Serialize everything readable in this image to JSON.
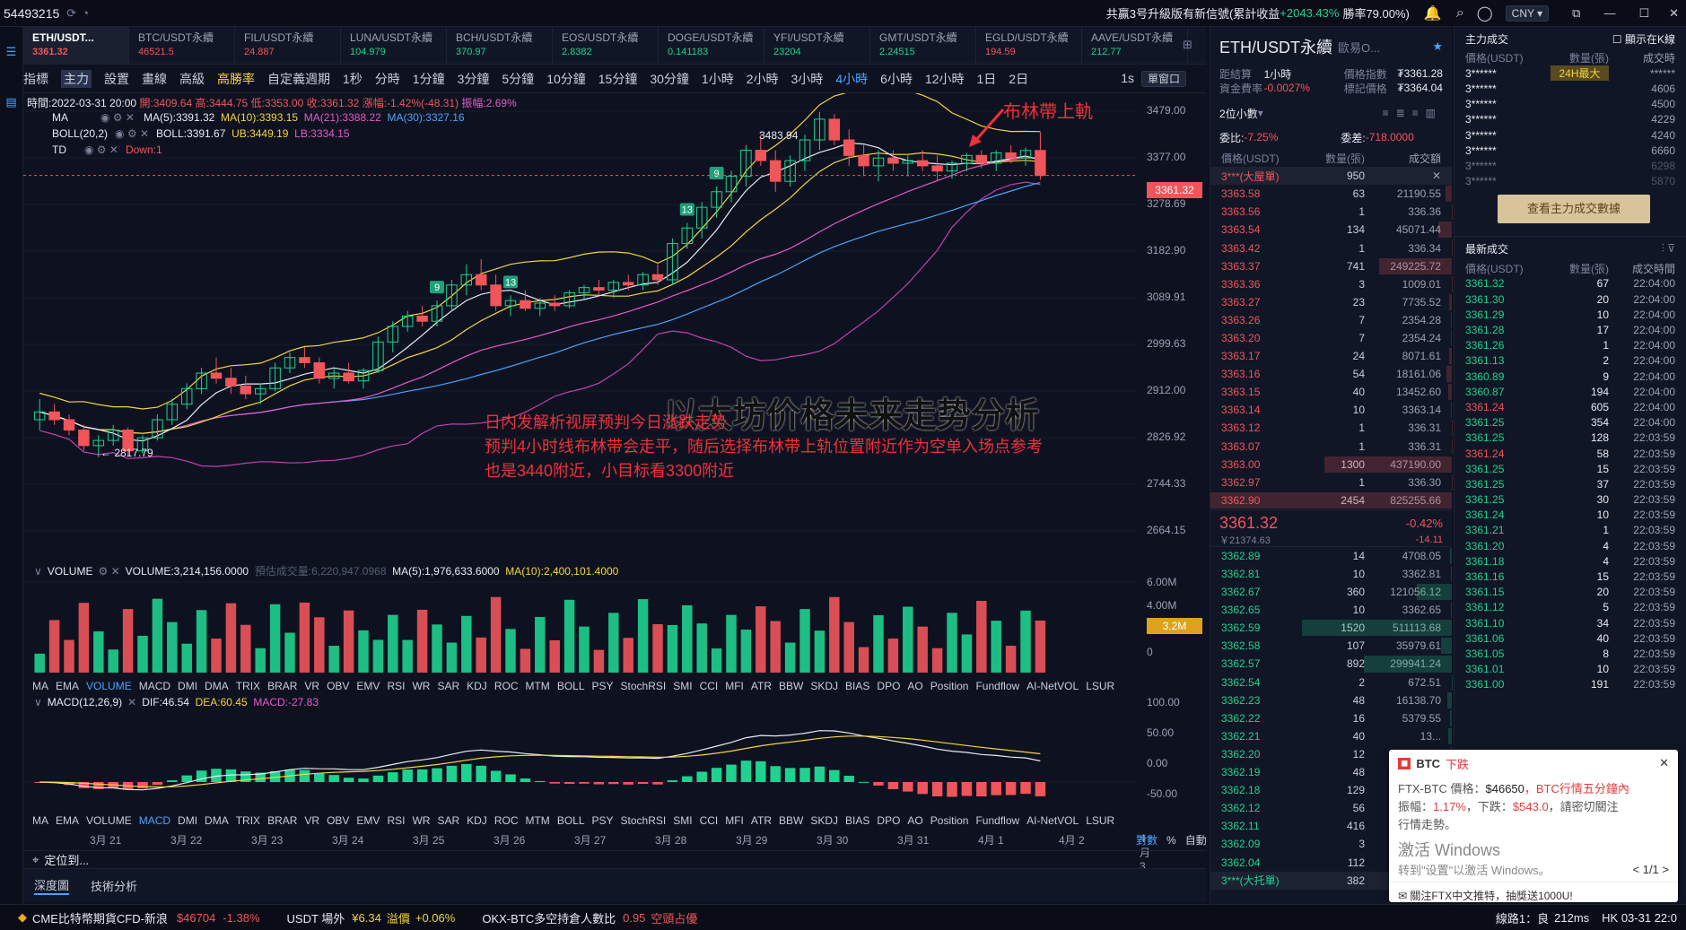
{
  "topbar": {
    "left_number": "54493215",
    "ticker": "共贏3号升級版有新信號(累計收益",
    "ticker_pct": "+2043.43%",
    "ticker_win": "勝率79.00%)",
    "currency": "CNY"
  },
  "tabs": [
    {
      "name": "ETH/USDT...",
      "price": "3361.32",
      "color": "#f0555a"
    },
    {
      "name": "BTC/USDT永續",
      "price": "46521.5",
      "color": "#f0555a"
    },
    {
      "name": "FIL/USDT永續",
      "price": "24.887",
      "color": "#f0555a"
    },
    {
      "name": "LUNA/USDT永續",
      "price": "104.979",
      "color": "#1fd28f"
    },
    {
      "name": "BCH/USDT永續",
      "price": "370.97",
      "color": "#1fd28f"
    },
    {
      "name": "EOS/USDT永續",
      "price": "2.8382",
      "color": "#1fd28f"
    },
    {
      "name": "DOGE/USDT永續",
      "price": "0.141183",
      "color": "#1fd28f"
    },
    {
      "name": "YFI/USDT永續",
      "price": "23204",
      "color": "#1fd28f"
    },
    {
      "name": "GMT/USDT永續",
      "price": "2.24515",
      "color": "#1fd28f"
    },
    {
      "name": "EGLD/USDT永續",
      "price": "194.59",
      "color": "#f0555a"
    },
    {
      "name": "AAVE/USDT永續",
      "price": "212.77",
      "color": "#1fd28f"
    }
  ],
  "toolbar": {
    "items": [
      "指標",
      "主力",
      "設置",
      "畫線",
      "高級",
      "高勝率",
      "自定義週期",
      "1秒",
      "分時",
      "1分鐘",
      "3分鐘",
      "5分鐘",
      "10分鐘",
      "15分鐘",
      "30分鐘",
      "1小時",
      "2小時",
      "3小時",
      "4小時",
      "6小時",
      "12小時",
      "1日",
      "2日"
    ],
    "active": "4小時",
    "right": [
      "1s",
      "單窗口"
    ]
  },
  "ohlc": {
    "time": "時間:2022-03-31 20:00",
    "open": "開:3409.64",
    "high": "高:3444.75",
    "low": "低:3353.00",
    "close": "收:3361.32",
    "change": "漲幅:-1.42%(-48.31)",
    "amp": "振幅:2.69%"
  },
  "ma_line": {
    "label": "MA",
    "ma5": "MA(5):3391.32",
    "ma10": "MA(10):3393.15",
    "ma21": "MA(21):3388.22",
    "ma30": "MA(30):3327.16"
  },
  "boll_line": {
    "label": "BOLL(20,2)",
    "boll": "BOLL:3391.67",
    "ub": "UB:3449.19",
    "lb": "LB:3334.15"
  },
  "td_line": {
    "label": "TD",
    "down": "Down:1"
  },
  "y_ticks": [
    "3479.00",
    "3377.00",
    "3278.69",
    "3182.90",
    "3089.91",
    "2999.63",
    "2912.00",
    "2826.92",
    "2744.33",
    "2664.15"
  ],
  "price_tag": "3361.32",
  "labels": {
    "high": "3483.94",
    "low": "← 2817.79",
    "boll_top": "布林帶上軌",
    "title_overlay": "以太坊价格未来走势分析",
    "note1": "日内发解析视屏预判今日涨跌走势",
    "note2": "预判4小时线布林带会走平，随后选择布林带上轨位置附近作为空单入场点参考",
    "note3": "也是3440附近，小目标看3300附近"
  },
  "td_marks": [
    "9",
    "13",
    "13",
    "9"
  ],
  "volume": {
    "label": "VOLUME",
    "value": "VOLUME:3,214,156.0000",
    "pred": "預估成交量:6,220,947.0968",
    "ma5": "MA(5):1,976,633.6000",
    "ma10": "MA(10):2,400,101.4000",
    "ticks": [
      "6.00M",
      "4.00M",
      "2.00M",
      "0"
    ],
    "tag": "3.2M"
  },
  "indicator_tabs1": [
    "MA",
    "EMA",
    "VOLUME",
    "MACD",
    "DMI",
    "DMA",
    "TRIX",
    "BRAR",
    "VR",
    "OBV",
    "EMV",
    "RSI",
    "WR",
    "SAR",
    "KDJ",
    "ROC",
    "MTM",
    "BOLL",
    "PSY",
    "StochRSI",
    "SMI",
    "CCI",
    "MFI",
    "ATR",
    "BBW",
    "SKDJ",
    "BIAS",
    "DPO",
    "AO",
    "Position",
    "Fundflow",
    "AI-NetVOL",
    "LSUR"
  ],
  "indicator_tabs2": [
    "MA",
    "EMA",
    "VOLUME",
    "MACD",
    "DMI",
    "DMA",
    "TRIX",
    "BRAR",
    "VR",
    "OBV",
    "EMV",
    "RSI",
    "WR",
    "SAR",
    "KDJ",
    "ROC",
    "MTM",
    "BOLL",
    "PSY",
    "StochRSI",
    "SMI",
    "CCI",
    "MFI",
    "ATR",
    "BBW",
    "SKDJ",
    "BIAS",
    "DPO",
    "AO",
    "Position",
    "Fundflow",
    "AI-NetVOL",
    "LSUR"
  ],
  "macd": {
    "label": "MACD(12,26,9)",
    "dif": "DIF:46.54",
    "dea": "DEA:60.45",
    "macd": "MACD:-27.83",
    "ticks": [
      "100.00",
      "50.00",
      "0.00",
      "-50.00"
    ]
  },
  "dates": [
    "3月 21",
    "3月 22",
    "3月 23",
    "3月 24",
    "3月 25",
    "3月 26",
    "3月 27",
    "3月 28",
    "3月 29",
    "3月 30",
    "3月 31",
    "4月 1",
    "4月 2",
    "4月 3"
  ],
  "date_right": [
    "對數",
    "%",
    "自動"
  ],
  "locate": "定位到...",
  "bottom_tabs": [
    "深度圖",
    "技術分析"
  ],
  "orderbook": {
    "title": "ETH/USDT永續",
    "exchange": "歐易O...",
    "info": [
      [
        "距結算",
        "1小時",
        "價格指數",
        "₮3361.28"
      ],
      [
        "資金費率",
        "-0.0027%",
        "標記價格",
        "₮3364.04"
      ]
    ],
    "precision": "2位小數",
    "ratio_label": "委比:",
    "ratio": "-7.25%",
    "diff_label": "委差:",
    "diff": "-718.0000",
    "headers": [
      "價格(USDT)",
      "數量(張)",
      "成交額"
    ],
    "big_ask": "3***(大屋單)",
    "big_ask_qty": "950",
    "asks": [
      [
        "3363.58",
        "63",
        "21190.55"
      ],
      [
        "3363.56",
        "1",
        "336.36"
      ],
      [
        "3363.54",
        "134",
        "45071.44"
      ],
      [
        "3363.42",
        "1",
        "336.34"
      ],
      [
        "3363.37",
        "741",
        "249225.72"
      ],
      [
        "3363.36",
        "3",
        "1009.01"
      ],
      [
        "3363.27",
        "23",
        "7735.52"
      ],
      [
        "3363.26",
        "7",
        "2354.28"
      ],
      [
        "3363.20",
        "7",
        "2354.24"
      ],
      [
        "3363.17",
        "24",
        "8071.61"
      ],
      [
        "3363.16",
        "54",
        "18161.06"
      ],
      [
        "3363.15",
        "40",
        "13452.60"
      ],
      [
        "3363.14",
        "10",
        "3363.14"
      ],
      [
        "3363.12",
        "1",
        "336.31"
      ],
      [
        "3363.07",
        "1",
        "336.31"
      ],
      [
        "3363.00",
        "1300",
        "437190.00"
      ],
      [
        "3362.97",
        "1",
        "336.30"
      ],
      [
        "3362.90",
        "2454",
        "825255.66"
      ]
    ],
    "last": "3361.32",
    "last_cny": "￥21374.63",
    "last_pct": "-0.42%",
    "last_chg": "-14.11",
    "bids": [
      [
        "3362.89",
        "14",
        "4708.05"
      ],
      [
        "3362.81",
        "10",
        "3362.81"
      ],
      [
        "3362.67",
        "360",
        "121056.12"
      ],
      [
        "3362.65",
        "10",
        "3362.65"
      ],
      [
        "3362.59",
        "1520",
        "511113.68"
      ],
      [
        "3362.58",
        "107",
        "35979.61"
      ],
      [
        "3362.57",
        "892",
        "299941.24"
      ],
      [
        "3362.54",
        "2",
        "672.51"
      ],
      [
        "3362.23",
        "48",
        "16138.70"
      ],
      [
        "3362.22",
        "16",
        "5379.55"
      ],
      [
        "3362.21",
        "40",
        "13..."
      ],
      [
        "3362.20",
        "12",
        "4..."
      ],
      [
        "3362.19",
        "48",
        "16..."
      ],
      [
        "3362.18",
        "129",
        "43..."
      ],
      [
        "3362.12",
        "56",
        "18..."
      ],
      [
        "3362.11",
        "416",
        "139..."
      ],
      [
        "3362.09",
        "3",
        "1..."
      ],
      [
        "3362.04",
        "112",
        "37..."
      ]
    ],
    "big_bid": "3***(大托單)",
    "big_bid_qty": "382"
  },
  "mainforce": {
    "title": "主力成交",
    "checkbox": "顯示在K線",
    "headers": [
      "價格(USDT)",
      "數量(張)",
      "成交時"
    ],
    "rows": [
      [
        "3******",
        "24H最大",
        "******"
      ],
      [
        "3******",
        "",
        "4606"
      ],
      [
        "3******",
        "",
        "4500"
      ],
      [
        "3******",
        "",
        "4229"
      ],
      [
        "3******",
        "",
        "4240"
      ],
      [
        "3******",
        "",
        "6660"
      ],
      [
        "3******",
        "",
        "6298"
      ],
      [
        "3******",
        "",
        "5870"
      ]
    ],
    "button": "查看主力成交數據"
  },
  "trades": {
    "title": "最新成交",
    "headers": [
      "價格(USDT)",
      "數量(張)",
      "成交時間"
    ],
    "rows": [
      [
        "3361.32",
        "67",
        "22:04:00",
        "g"
      ],
      [
        "3361.30",
        "20",
        "22:04:00",
        "g"
      ],
      [
        "3361.29",
        "10",
        "22:04:00",
        "g"
      ],
      [
        "3361.28",
        "17",
        "22:04:00",
        "g"
      ],
      [
        "3361.26",
        "1",
        "22:04:00",
        "g"
      ],
      [
        "3361.13",
        "2",
        "22:04:00",
        "g"
      ],
      [
        "3360.89",
        "9",
        "22:04:00",
        "g"
      ],
      [
        "3360.87",
        "194",
        "22:04:00",
        "g"
      ],
      [
        "3361.24",
        "605",
        "22:04:00",
        "r"
      ],
      [
        "3361.25",
        "354",
        "22:04:00",
        "g"
      ],
      [
        "3361.25",
        "128",
        "22:03:59",
        "g"
      ],
      [
        "3361.24",
        "58",
        "22:03:59",
        "r"
      ],
      [
        "3361.25",
        "15",
        "22:03:59",
        "g"
      ],
      [
        "3361.25",
        "37",
        "22:03:59",
        "g"
      ],
      [
        "3361.25",
        "30",
        "22:03:59",
        "g"
      ],
      [
        "3361.24",
        "10",
        "22:03:59",
        "g"
      ],
      [
        "3361.21",
        "1",
        "22:03:59",
        "g"
      ],
      [
        "3361.20",
        "4",
        "22:03:59",
        "g"
      ],
      [
        "3361.18",
        "4",
        "22:03:59",
        "g"
      ],
      [
        "3361.16",
        "15",
        "22:03:59",
        "g"
      ],
      [
        "3361.15",
        "20",
        "22:03:59",
        "g"
      ],
      [
        "3361.12",
        "5",
        "22:03:59",
        "g"
      ],
      [
        "3361.10",
        "34",
        "22:03:59",
        "g"
      ],
      [
        "3361.06",
        "40",
        "22:03:59",
        "g"
      ],
      [
        "3361.05",
        "8",
        "22:03:59",
        "g"
      ],
      [
        "3361.01",
        "10",
        "22:03:59",
        "g"
      ],
      [
        "3361.00",
        "191",
        "22:03:59",
        "g"
      ]
    ]
  },
  "popup": {
    "title": "BTC",
    "badge": "下跌",
    "line1a": "FTX-BTC 價格：",
    "line1b": "$46650",
    "line1c": "，BTC行情五分鐘內",
    "line2a": "振幅：",
    "line2b": "1.17%",
    "line2c": "，下跌：",
    "line2d": "$543.0",
    "line2e": "，請密切關注",
    "line3": "行情走勢。",
    "win1": "激活 Windows",
    "win2": "转到\"设置\"以激活 Windows。",
    "pager": "< 1/1 >",
    "footer": "關注FTX中文推特，抽獎送1000U!"
  },
  "bottombar": {
    "a": "CME比特幣期貨CFD-新浪",
    "a_val": "$46704",
    "a_pct": "-1.38%",
    "b": "USDT 場外",
    "b_val": "¥6.34",
    "b_lbl": "溢價",
    "b_pct": "+0.06%",
    "c": "OKX-BTC多空持倉人數比",
    "c_val": "0.95",
    "c_lbl": "空頭占優",
    "d": "線路1：良",
    "d_ms": "212ms",
    "e": "HK 03-31 22:0"
  },
  "chart_data": {
    "type": "candlestick",
    "y_range": [
      2620,
      3520
    ],
    "candles": [
      [
        2890,
        2930,
        2870,
        2905
      ],
      [
        2905,
        2920,
        2880,
        2890
      ],
      [
        2890,
        2900,
        2860,
        2870
      ],
      [
        2870,
        2880,
        2830,
        2840
      ],
      [
        2840,
        2860,
        2817.79,
        2850
      ],
      [
        2850,
        2880,
        2840,
        2870
      ],
      [
        2870,
        2875,
        2820,
        2830
      ],
      [
        2830,
        2860,
        2825,
        2855
      ],
      [
        2855,
        2900,
        2850,
        2890
      ],
      [
        2890,
        2930,
        2880,
        2920
      ],
      [
        2920,
        2960,
        2910,
        2950
      ],
      [
        2950,
        2990,
        2940,
        2980
      ],
      [
        2980,
        3010,
        2960,
        2970
      ],
      [
        2970,
        2990,
        2940,
        2955
      ],
      [
        2955,
        2975,
        2930,
        2940
      ],
      [
        2940,
        2960,
        2920,
        2950
      ],
      [
        2950,
        3000,
        2945,
        2990
      ],
      [
        2990,
        3020,
        2980,
        3010
      ],
      [
        3010,
        3030,
        2990,
        3000
      ],
      [
        3000,
        3010,
        2960,
        2970
      ],
      [
        2970,
        2990,
        2950,
        2980
      ],
      [
        2980,
        3000,
        2960,
        2965
      ],
      [
        2965,
        2990,
        2950,
        2985
      ],
      [
        2985,
        3050,
        2980,
        3040
      ],
      [
        3040,
        3080,
        3020,
        3070
      ],
      [
        3070,
        3100,
        3060,
        3090
      ],
      [
        3090,
        3110,
        3070,
        3080
      ],
      [
        3080,
        3120,
        3070,
        3110
      ],
      [
        3110,
        3160,
        3100,
        3150
      ],
      [
        3150,
        3190,
        3130,
        3170
      ],
      [
        3170,
        3200,
        3140,
        3150
      ],
      [
        3150,
        3170,
        3100,
        3110
      ],
      [
        3110,
        3130,
        3090,
        3120
      ],
      [
        3120,
        3140,
        3100,
        3105
      ],
      [
        3105,
        3125,
        3090,
        3115
      ],
      [
        3115,
        3130,
        3100,
        3110
      ],
      [
        3110,
        3140,
        3105,
        3135
      ],
      [
        3135,
        3150,
        3120,
        3145
      ],
      [
        3145,
        3160,
        3130,
        3140
      ],
      [
        3140,
        3160,
        3125,
        3155
      ],
      [
        3155,
        3170,
        3140,
        3150
      ],
      [
        3150,
        3175,
        3140,
        3170
      ],
      [
        3170,
        3190,
        3150,
        3160
      ],
      [
        3160,
        3240,
        3150,
        3230
      ],
      [
        3230,
        3270,
        3220,
        3260
      ],
      [
        3260,
        3310,
        3240,
        3300
      ],
      [
        3300,
        3340,
        3280,
        3330
      ],
      [
        3330,
        3370,
        3310,
        3360
      ],
      [
        3360,
        3420,
        3340,
        3410
      ],
      [
        3410,
        3440,
        3380,
        3390
      ],
      [
        3390,
        3410,
        3330,
        3350
      ],
      [
        3350,
        3400,
        3340,
        3390
      ],
      [
        3390,
        3440,
        3370,
        3430
      ],
      [
        3430,
        3483.94,
        3410,
        3470
      ],
      [
        3470,
        3480,
        3420,
        3430
      ],
      [
        3430,
        3450,
        3380,
        3400
      ],
      [
        3400,
        3420,
        3360,
        3380
      ],
      [
        3380,
        3410,
        3350,
        3395
      ],
      [
        3395,
        3410,
        3370,
        3385
      ],
      [
        3385,
        3400,
        3360,
        3390
      ],
      [
        3390,
        3410,
        3370,
        3380
      ],
      [
        3380,
        3400,
        3350,
        3370
      ],
      [
        3370,
        3390,
        3355,
        3385
      ],
      [
        3385,
        3405,
        3370,
        3400
      ],
      [
        3400,
        3410,
        3375,
        3385
      ],
      [
        3385,
        3410,
        3370,
        3405
      ],
      [
        3405,
        3420,
        3385,
        3395
      ],
      [
        3395,
        3415,
        3380,
        3409.64
      ],
      [
        3409.64,
        3444.75,
        3353,
        3361.32
      ]
    ],
    "volume_max": 6.5
  }
}
